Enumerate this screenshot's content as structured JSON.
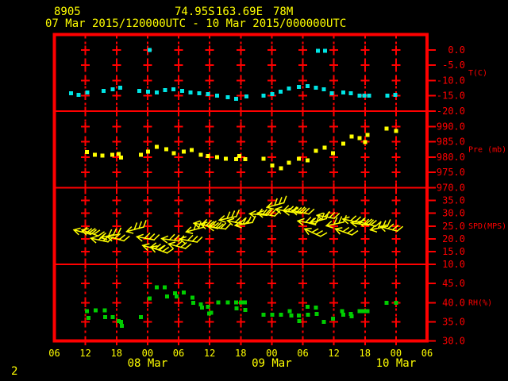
{
  "header": {
    "station_id": "8905",
    "latitude": "74.95S",
    "longitude": "163.69E",
    "elevation": "78M",
    "time_range": "07 Mar 2015/120000UTC - 10 Mar 2015/000000UTC"
  },
  "page_number": "2",
  "colors": {
    "background": "#000000",
    "frame_and_axis": "#ff0000",
    "title_and_xlabels": "#ffff00",
    "temperature_series": "#00e5e5",
    "pressure_series": "#ffff00",
    "wind_series": "#ffff00",
    "humidity_series": "#00cd00"
  },
  "chart_data": {
    "type": "scatter",
    "title": "8905  74.95S 163.69E 78M  07 Mar 2015/120000UTC - 10 Mar 2015/000000UTC",
    "x_axis": {
      "total_hours": 72,
      "tick_interval_hours": 6,
      "hour_labels": [
        "06",
        "12",
        "18",
        "00",
        "06",
        "12",
        "18",
        "00",
        "06",
        "12",
        "18",
        "00",
        "06"
      ],
      "date_labels": [
        {
          "text": "08 Mar",
          "tick_index": 3
        },
        {
          "text": "09 Mar",
          "tick_index": 7
        },
        {
          "text": "10 Mar",
          "tick_index": 11
        }
      ],
      "grid": "dashed-verticals-with-crosses"
    },
    "panels": [
      {
        "name": "temperature",
        "unit_label": "T(C)",
        "color": "#00e5e5",
        "ticks": [
          0.0,
          -5.0,
          -10.0,
          -15.0,
          -20.0
        ],
        "points": [
          [
            3.2,
            -14.2
          ],
          [
            4.7,
            -14.7
          ],
          [
            6.4,
            -13.9
          ],
          [
            9.5,
            -13.4
          ],
          [
            11.3,
            -12.9
          ],
          [
            12.7,
            -12.4
          ],
          [
            16.4,
            -13.4
          ],
          [
            18.1,
            -13.7
          ],
          [
            18.4,
            -0.1
          ],
          [
            19.8,
            -13.9
          ],
          [
            21.4,
            -13.1
          ],
          [
            23.0,
            -12.9
          ],
          [
            24.7,
            -13.4
          ],
          [
            26.3,
            -13.9
          ],
          [
            28.0,
            -14.2
          ],
          [
            29.7,
            -14.4
          ],
          [
            31.4,
            -14.9
          ],
          [
            33.5,
            -15.5
          ],
          [
            35.1,
            -16.0
          ],
          [
            37.1,
            -15.2
          ],
          [
            40.4,
            -14.9
          ],
          [
            42.1,
            -14.4
          ],
          [
            43.7,
            -13.7
          ],
          [
            45.3,
            -12.6
          ],
          [
            47.2,
            -12.1
          ],
          [
            48.9,
            -11.9
          ],
          [
            50.5,
            -12.4
          ],
          [
            50.9,
            -0.3
          ],
          [
            52.1,
            -12.9
          ],
          [
            52.3,
            -0.3
          ],
          [
            53.6,
            -14.2
          ],
          [
            55.8,
            -13.9
          ],
          [
            57.3,
            -14.2
          ],
          [
            59.0,
            -14.9
          ],
          [
            59.9,
            -14.9
          ],
          [
            60.8,
            -14.9
          ],
          [
            64.3,
            -14.9
          ],
          [
            65.9,
            -14.7
          ]
        ]
      },
      {
        "name": "pressure",
        "unit_label": "Pre (mb)",
        "color": "#ffff00",
        "ticks": [
          990.0,
          985.0,
          980.0,
          975.0,
          970.0
        ],
        "points": [
          [
            6.3,
            981.6
          ],
          [
            7.8,
            980.8
          ],
          [
            9.3,
            980.5
          ],
          [
            11.2,
            980.8
          ],
          [
            12.4,
            981.0
          ],
          [
            12.9,
            979.8
          ],
          [
            16.7,
            980.8
          ],
          [
            18.1,
            981.8
          ],
          [
            19.8,
            983.4
          ],
          [
            21.6,
            982.6
          ],
          [
            23.1,
            981.3
          ],
          [
            25.0,
            981.8
          ],
          [
            26.5,
            982.3
          ],
          [
            28.3,
            980.8
          ],
          [
            29.7,
            980.3
          ],
          [
            31.4,
            980.0
          ],
          [
            33.1,
            979.5
          ],
          [
            35.1,
            979.3
          ],
          [
            35.7,
            980.3
          ],
          [
            36.9,
            979.3
          ],
          [
            40.4,
            979.5
          ],
          [
            42.1,
            977.2
          ],
          [
            43.8,
            976.4
          ],
          [
            45.3,
            978.2
          ],
          [
            47.2,
            979.5
          ],
          [
            48.9,
            979.0
          ],
          [
            50.5,
            982.1
          ],
          [
            52.2,
            983.1
          ],
          [
            53.8,
            981.3
          ],
          [
            55.8,
            984.4
          ],
          [
            57.4,
            986.7
          ],
          [
            59.0,
            986.2
          ],
          [
            60.0,
            984.9
          ],
          [
            60.5,
            987.2
          ],
          [
            64.2,
            989.3
          ],
          [
            66.0,
            988.5
          ]
        ]
      },
      {
        "name": "wind_speed",
        "unit_label": "SPD(MPS)",
        "color": "#ffff00",
        "ticks": [
          35.0,
          30.0,
          25.0,
          20.0,
          15.0,
          10.0
        ],
        "barbs": [
          [
            5.4,
            22.6,
            15
          ],
          [
            6.9,
            22.3,
            20
          ],
          [
            8.7,
            19.5,
            12
          ],
          [
            10.6,
            21.1,
            -10
          ],
          [
            11.8,
            20.1,
            15
          ],
          [
            15.6,
            23.7,
            -15
          ],
          [
            17.6,
            20.2,
            10
          ],
          [
            18.7,
            16.5,
            15
          ],
          [
            20.2,
            15.6,
            20
          ],
          [
            22.4,
            19.6,
            8
          ],
          [
            23.7,
            17.1,
            15
          ],
          [
            25.9,
            19.3,
            10
          ],
          [
            27.1,
            23.6,
            -15
          ],
          [
            28.6,
            25.5,
            10
          ],
          [
            29.9,
            24.9,
            15
          ],
          [
            31.4,
            24.3,
            8
          ],
          [
            33.5,
            28.0,
            -12
          ],
          [
            35.1,
            26.4,
            12
          ],
          [
            36.6,
            25.8,
            -10
          ],
          [
            39.4,
            29.5,
            5
          ],
          [
            40.9,
            29.5,
            10
          ],
          [
            42.7,
            33.2,
            -15
          ],
          [
            44.4,
            31.0,
            10
          ],
          [
            46.0,
            30.4,
            8
          ],
          [
            47.5,
            30.4,
            12
          ],
          [
            48.7,
            26.4,
            10
          ],
          [
            49.9,
            22.4,
            25
          ],
          [
            50.9,
            27.0,
            -15
          ],
          [
            52.4,
            28.6,
            10
          ],
          [
            54.2,
            25.8,
            -12
          ],
          [
            55.9,
            22.7,
            20
          ],
          [
            57.4,
            27.0,
            12
          ],
          [
            59.0,
            25.8,
            8
          ],
          [
            60.4,
            25.8,
            15
          ],
          [
            62.7,
            24.2,
            -12
          ],
          [
            64.6,
            23.9,
            15
          ]
        ]
      },
      {
        "name": "relative_humidity",
        "unit_label": "RH(%)",
        "color": "#00cd00",
        "ticks": [
          45.0,
          40.0,
          35.0,
          30.0
        ],
        "points": [
          [
            6.3,
            37.8
          ],
          [
            6.6,
            36.0
          ],
          [
            8.0,
            38.0
          ],
          [
            9.7,
            38.0
          ],
          [
            9.8,
            36.2
          ],
          [
            11.3,
            36.2
          ],
          [
            12.4,
            35.2
          ],
          [
            12.9,
            35.0
          ],
          [
            13.0,
            33.9
          ],
          [
            16.7,
            36.2
          ],
          [
            18.4,
            41.1
          ],
          [
            19.8,
            44.0
          ],
          [
            21.3,
            44.0
          ],
          [
            21.8,
            41.6
          ],
          [
            23.3,
            42.4
          ],
          [
            23.6,
            41.6
          ],
          [
            25.0,
            42.6
          ],
          [
            26.7,
            41.3
          ],
          [
            26.8,
            39.9
          ],
          [
            28.3,
            39.5
          ],
          [
            28.5,
            38.7
          ],
          [
            29.7,
            38.9
          ],
          [
            29.9,
            37.2
          ],
          [
            30.3,
            37.4
          ],
          [
            31.7,
            40.1
          ],
          [
            33.5,
            40.1
          ],
          [
            35.1,
            40.1
          ],
          [
            35.2,
            38.5
          ],
          [
            36.0,
            40.1
          ],
          [
            36.8,
            40.1
          ],
          [
            36.9,
            38.1
          ],
          [
            40.4,
            36.8
          ],
          [
            42.1,
            36.8
          ],
          [
            43.8,
            36.8
          ],
          [
            45.5,
            37.8
          ],
          [
            45.8,
            36.6
          ],
          [
            47.2,
            36.6
          ],
          [
            47.3,
            35.2
          ],
          [
            48.9,
            38.9
          ],
          [
            49.0,
            36.8
          ],
          [
            50.5,
            38.7
          ],
          [
            50.7,
            37.0
          ],
          [
            52.1,
            35.0
          ],
          [
            53.8,
            35.8
          ],
          [
            55.6,
            37.8
          ],
          [
            55.8,
            36.8
          ],
          [
            57.3,
            37.0
          ],
          [
            57.4,
            36.4
          ],
          [
            59.0,
            37.8
          ],
          [
            59.6,
            37.8
          ],
          [
            60.0,
            37.8
          ],
          [
            60.5,
            37.8
          ],
          [
            64.2,
            39.9
          ],
          [
            66.0,
            39.9
          ]
        ]
      }
    ]
  }
}
